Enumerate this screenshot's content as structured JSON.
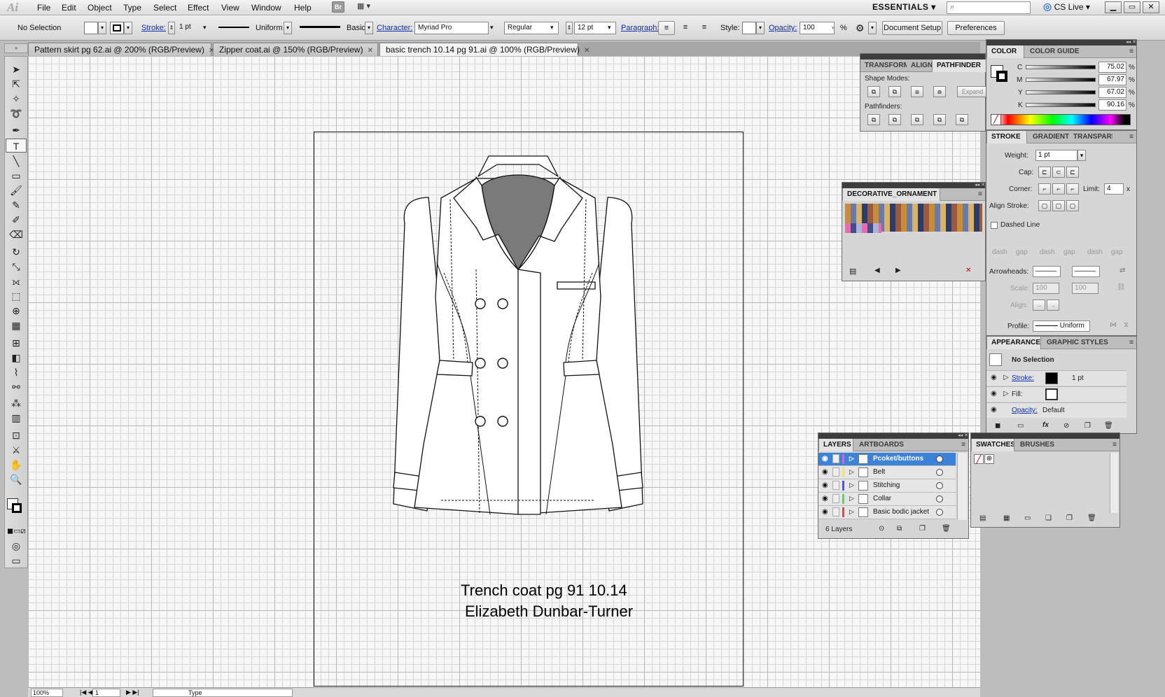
{
  "app": {
    "logo": "Ai"
  },
  "menu": [
    "File",
    "Edit",
    "Object",
    "Type",
    "Select",
    "Effect",
    "View",
    "Window",
    "Help"
  ],
  "menubar_right": {
    "bridge": "Br",
    "workspace": "ESSENTIALS",
    "cs_live": "CS Live",
    "search_placeholder": ""
  },
  "control": {
    "selection": "No Selection",
    "stroke_label": "Stroke:",
    "stroke_weight": "1 pt",
    "profile": "Uniform",
    "brush": "Basic",
    "character_label": "Character:",
    "font": "Myriad Pro",
    "style_value": "Regular",
    "size": "12 pt",
    "paragraph_label": "Paragraph:",
    "style_label": "Style:",
    "opacity_label": "Opacity:",
    "opacity": "100",
    "opacity_unit": "%",
    "document_setup": "Document Setup",
    "preferences": "Preferences"
  },
  "tabs": [
    {
      "label": "Pattern skirt pg 62.ai @ 200% (RGB/Preview)"
    },
    {
      "label": "Zipper  coat.ai @ 150% (RGB/Preview)"
    },
    {
      "label": "basic trench 10.14 pg 91.ai @ 100% (RGB/Preview)"
    }
  ],
  "canvas": {
    "caption_line1": "Trench coat pg 91 10.14",
    "caption_line2": "Elizabeth Dunbar-Turner"
  },
  "pathfinder_panel": {
    "tabs": [
      "TRANSFORM",
      "ALIGN",
      "PATHFINDER"
    ],
    "shape_modes": "Shape Modes:",
    "pathfinders": "Pathfinders:",
    "expand": "Expand"
  },
  "color_panel": {
    "tabs": [
      "COLOR",
      "COLOR GUIDE"
    ],
    "channels": [
      {
        "name": "C",
        "value": "75.02",
        "level": 0.75
      },
      {
        "name": "M",
        "value": "67.97",
        "level": 0.68
      },
      {
        "name": "Y",
        "value": "67.02",
        "level": 0.67
      },
      {
        "name": "K",
        "value": "90.16",
        "level": 0.9
      }
    ],
    "unit": "%"
  },
  "stroke_panel": {
    "tabs": [
      "STROKE",
      "GRADIENT",
      "TRANSPARENCY"
    ],
    "weight_label": "Weight:",
    "weight": "1 pt",
    "cap_label": "Cap:",
    "corner_label": "Corner:",
    "limit_label": "Limit:",
    "limit": "4",
    "limit_unit": "x",
    "align_label": "Align Stroke:",
    "dashed_line": "Dashed Line",
    "dash_labels": [
      "dash",
      "gap",
      "dash",
      "gap",
      "dash",
      "gap"
    ],
    "arrowheads_label": "Arrowheads:",
    "scale_label": "Scale:",
    "scale1": "100",
    "scale2": "100",
    "align2_label": "Align:",
    "profile_label": "Profile:",
    "profile": "Uniform"
  },
  "ornament_panel": {
    "title": "DECORATIVE_ORNAMENT"
  },
  "appearance_panel": {
    "tabs": [
      "APPEARANCE",
      "GRAPHIC STYLES"
    ],
    "selection": "No Selection",
    "stroke_label": "Stroke:",
    "stroke_value": "1 pt",
    "fill_label": "Fill:",
    "opacity_label": "Opacity:",
    "opacity_value": "Default"
  },
  "layers_panel": {
    "tabs": [
      "LAYERS",
      "ARTBOARDS"
    ],
    "layers": [
      {
        "name": "Pcoket/buttons",
        "color": "#ff4fd8"
      },
      {
        "name": "Belt",
        "color": "#ffe24f"
      },
      {
        "name": "Stitching",
        "color": "#4f4fff"
      },
      {
        "name": "Collar",
        "color": "#4fe04f"
      },
      {
        "name": "Basic bodic jacket",
        "color": "#ff3b3b"
      }
    ],
    "count": "6 Layers"
  },
  "swatches_panel": {
    "tabs": [
      "SWATCHES",
      "BRUSHES"
    ]
  },
  "status": {
    "zoom": "100%",
    "artboard": "1",
    "tool": "Type"
  }
}
